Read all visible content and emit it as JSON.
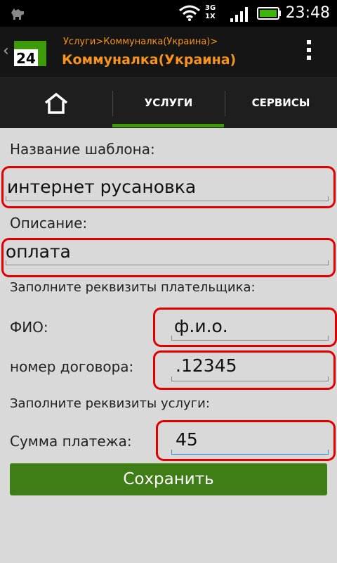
{
  "status_bar": {
    "time": "23:48",
    "network_top": "3G",
    "network_bottom": "1X",
    "icons": [
      "android-icon",
      "wifi-icon",
      "signal-icon",
      "battery-icon"
    ]
  },
  "action_bar": {
    "breadcrumb": "Услуги>Коммуналка(Украина)>",
    "title": "Коммуналка(Украина)",
    "logo_text": "24",
    "accent_color": "#f7941d",
    "logo_color": "#3e9a0b"
  },
  "tabs": [
    {
      "label": "",
      "icon": "home-icon"
    },
    {
      "label": "УСЛУГИ",
      "selected": true
    },
    {
      "label": "СЕРВИСЫ"
    }
  ],
  "form": {
    "template_name_label": "Название шаблона:",
    "template_name_value": "интернет русановка",
    "description_label": "Описание:",
    "description_value": "оплата",
    "payer_section": "Заполните реквизиты плательщика:",
    "fio_label": "ФИО:",
    "fio_value": "ф.и.о.",
    "contract_label": "номер договора:",
    "contract_value": ".12345",
    "service_section": "Заполните реквизиты услуги:",
    "amount_label": "Сумма платежа:",
    "amount_value": "45",
    "save_label": "Сохранить",
    "button_color": "#3f7d16",
    "highlight_color": "#e00000"
  }
}
